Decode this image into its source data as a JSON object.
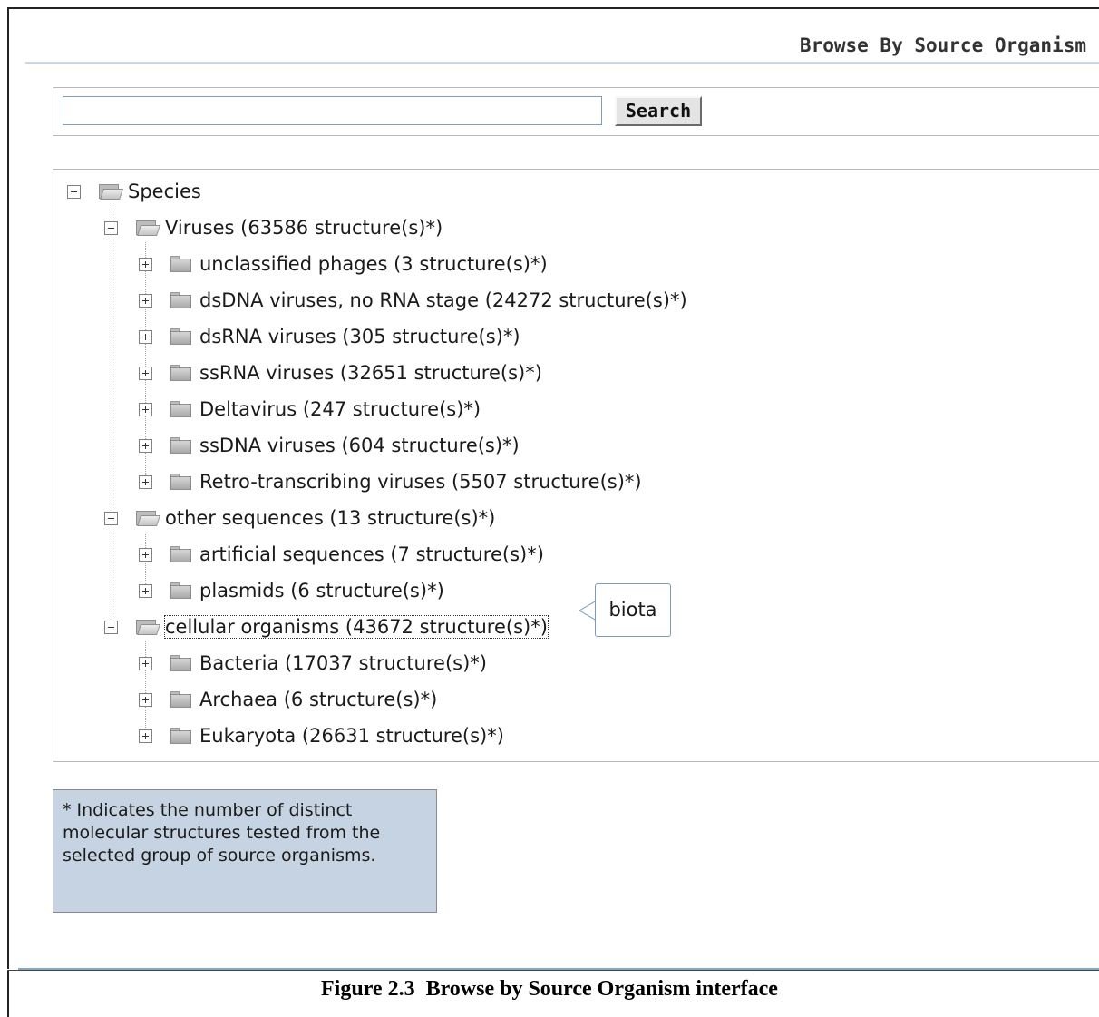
{
  "header": {
    "title": "Browse By Source Organism"
  },
  "search": {
    "value": "",
    "placeholder": "",
    "button_label": "Search"
  },
  "tree": {
    "species": "Species",
    "viruses": "Viruses (63586 structure(s)*)",
    "virus_children": [
      "unclassified phages (3 structure(s)*)",
      "dsDNA viruses, no RNA stage (24272 structure(s)*)",
      "dsRNA viruses (305 structure(s)*)",
      "ssRNA viruses (32651 structure(s)*)",
      "Deltavirus (247 structure(s)*)",
      "ssDNA viruses (604 structure(s)*)",
      "Retro-transcribing viruses (5507 structure(s)*)"
    ],
    "other_sequences": "other sequences (13 structure(s)*)",
    "other_children": [
      "artificial sequences (7 structure(s)*)",
      "plasmids (6 structure(s)*)"
    ],
    "cellular_organisms": "cellular organisms (43672 structure(s)*)",
    "cellular_children": [
      "Bacteria (17037 structure(s)*)",
      "Archaea (6 structure(s)*)",
      "Eukaryota (26631 structure(s)*)"
    ]
  },
  "tooltip": {
    "text": "biota"
  },
  "footnote": {
    "text": "* Indicates the number of distinct molecular structures tested from the selected group of source organisms."
  },
  "caption": {
    "text": "Figure 2.3  Browse by Source Organism interface"
  },
  "icons": {
    "collapse": "minus-box-icon",
    "expand": "plus-box-icon",
    "open_folder": "open-folder-icon",
    "closed_folder": "folder-icon"
  }
}
